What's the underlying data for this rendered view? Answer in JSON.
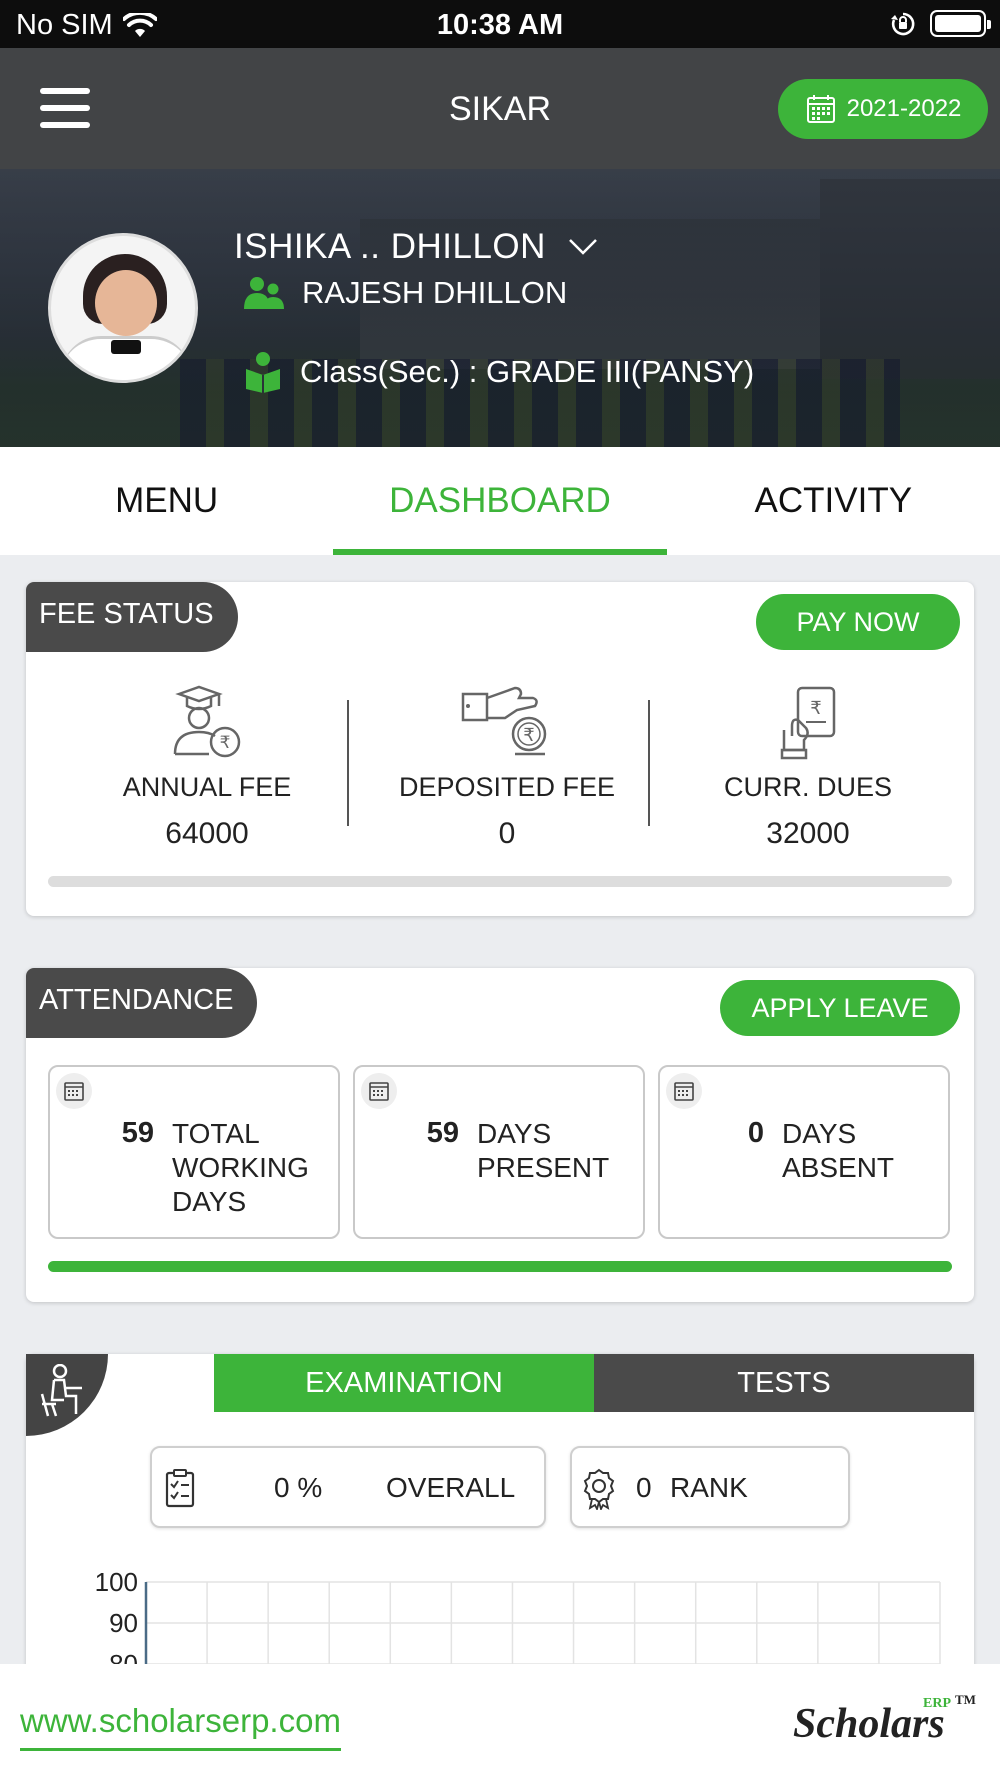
{
  "status_bar": {
    "carrier": "No SIM",
    "time": "10:38 AM"
  },
  "app_bar": {
    "title": "SIKAR",
    "session": "2021-2022"
  },
  "student": {
    "name": "ISHIKA .. DHILLON",
    "parent": "RAJESH DHILLON",
    "class": "Class(Sec.) : GRADE III(PANSY)"
  },
  "tabs": [
    {
      "label": "MENU",
      "active": false
    },
    {
      "label": "DASHBOARD",
      "active": true
    },
    {
      "label": "ACTIVITY",
      "active": false
    }
  ],
  "fee_status": {
    "title": "FEE STATUS",
    "pay_button": "PAY NOW",
    "items": [
      {
        "label": "ANNUAL FEE",
        "value": "64000"
      },
      {
        "label": "DEPOSITED FEE",
        "value": "0"
      },
      {
        "label": "CURR. DUES",
        "value": "32000"
      }
    ],
    "progress": 0
  },
  "attendance": {
    "title": "ATTENDANCE",
    "leave_button": "APPLY LEAVE",
    "items": [
      {
        "value": "59",
        "label": "TOTAL WORKING DAYS"
      },
      {
        "value": "59",
        "label": "DAYS PRESENT"
      },
      {
        "value": "0",
        "label": "DAYS ABSENT"
      }
    ],
    "progress": 1
  },
  "exam": {
    "tabs": [
      "EXAMINATION",
      "TESTS"
    ],
    "active_tab": "EXAMINATION",
    "overall_value": "0 %",
    "overall_label": "OVERALL",
    "rank_value": "0",
    "rank_label": "RANK"
  },
  "chart_data": {
    "type": "bar",
    "categories": [],
    "values": [],
    "ylim": [
      0,
      100
    ],
    "ytick_labels": [
      "100",
      "90",
      "80"
    ],
    "grid": true
  },
  "footer": {
    "link": "www.scholarserp.com",
    "brand": "Scholars",
    "brand_sup": "ERP",
    "brand_tm": "TM"
  },
  "colors": {
    "accent": "#3db43a",
    "dark": "#424446",
    "label_bg": "#4a4a4a"
  }
}
